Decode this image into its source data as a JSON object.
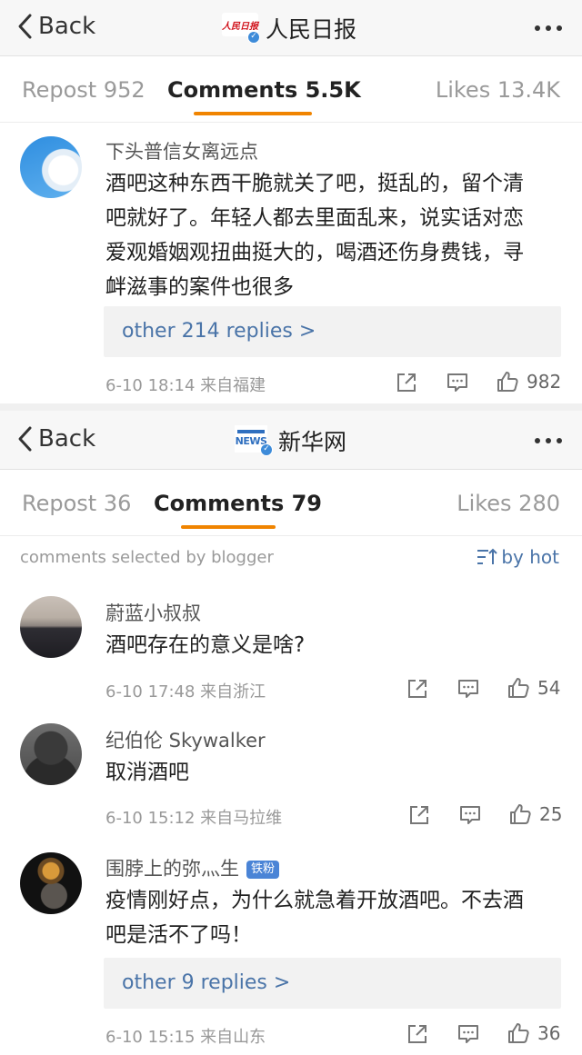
{
  "panel1": {
    "nav": {
      "back_label": "Back",
      "title": "人民日报",
      "logo_text": "人民日报"
    },
    "tabs": {
      "repost": "Repost 952",
      "comments": "Comments 5.5K",
      "likes": "Likes 13.4K"
    },
    "comment": {
      "username": "下头普信女离远点",
      "lines": [
        "酒吧这种东西干脆就关了吧，挺乱的，留个清",
        "吧就好了。年轻人都去里面乱来，说实话对恋",
        "爱观婚姻观扭曲挺大的，喝酒还伤身费钱，寻",
        "衅滋事的案件也很多"
      ],
      "replies": "other 214 replies >",
      "time": "6-10 18:14 来自福建",
      "likes": "982"
    }
  },
  "panel2": {
    "nav": {
      "back_label": "Back",
      "title": "新华网",
      "logo_text": "新华网"
    },
    "tabs": {
      "repost": "Repost 36",
      "comments": "Comments 79",
      "likes": "Likes 280"
    },
    "selected_label": "comments selected by blogger",
    "sort_label": "by hot",
    "comments": [
      {
        "username": "蔚蓝小叔叔",
        "lines": [
          "酒吧存在的意义是啥?"
        ],
        "time": "6-10 17:48 来自浙江",
        "likes": "54"
      },
      {
        "username": "纪伯伦 Skywalker",
        "lines": [
          "取消酒吧"
        ],
        "time": "6-10 15:12 来自马拉维",
        "likes": "25"
      },
      {
        "username": "围脖上的弥灬生",
        "badge": "铁粉",
        "lines": [
          "疫情刚好点，为什么就急着开放酒吧。不去酒",
          "吧是活不了吗！"
        ],
        "replies": "other 9 replies >",
        "time": "6-10 15:15 来自山东",
        "likes": "36"
      }
    ]
  },
  "icons": {
    "back": "chevron-left-icon",
    "more": "more-dots-icon",
    "repost": "share-icon",
    "comment": "comment-icon",
    "like": "thumbs-up-icon",
    "sort": "sort-icon",
    "verified": "verified-icon"
  },
  "colors": {
    "accent": "#f08400",
    "link": "#4a74a8",
    "badge": "#4a84d6",
    "verified": "#3d8bd9"
  }
}
